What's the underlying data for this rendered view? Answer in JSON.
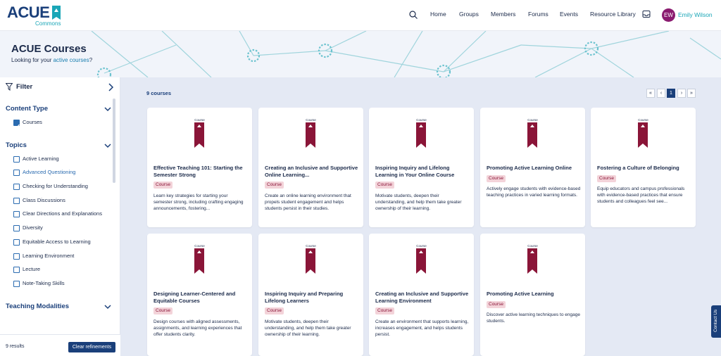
{
  "brand": {
    "name": "ACUE",
    "sub": "Commons",
    "accent": "#1aa6b7",
    "navy": "#1a3f7a",
    "maroon": "#8a1538"
  },
  "nav": {
    "search_icon": "search-icon",
    "items": [
      "Home",
      "Groups",
      "Members",
      "Forums",
      "Events",
      "Resource Library"
    ],
    "inbox_icon": "inbox-icon",
    "avatar_initials": "EW",
    "user_name": "Emily Wilson"
  },
  "hero": {
    "title": "ACUE Courses",
    "subtitle_prefix": "Looking for your ",
    "subtitle_link": "active courses",
    "subtitle_suffix": "?"
  },
  "sidebar": {
    "filter_label": "Filter",
    "content_type": {
      "title": "Content Type",
      "options": [
        {
          "label": "Courses",
          "checked": true
        }
      ]
    },
    "topics": {
      "title": "Topics",
      "options": [
        {
          "label": "Active Learning",
          "checked": false
        },
        {
          "label": "Advanced Questioning",
          "checked": false
        },
        {
          "label": "Checking for Understanding",
          "checked": false
        },
        {
          "label": "Class Discussions",
          "checked": false
        },
        {
          "label": "Clear Directions and Explanations",
          "checked": false
        },
        {
          "label": "Diversity",
          "checked": false
        },
        {
          "label": "Equitable Access to Learning",
          "checked": false
        },
        {
          "label": "Learning Environment",
          "checked": false
        },
        {
          "label": "Lecture",
          "checked": false
        },
        {
          "label": "Note-Taking Skills",
          "checked": false
        }
      ]
    },
    "teaching_modalities": {
      "title": "Teaching Modalities"
    },
    "results_count": "9 results",
    "clear_label": "Clear refinements"
  },
  "main": {
    "count_label": "9 courses",
    "pager": [
      "«",
      "‹",
      "1",
      "›",
      "»"
    ],
    "current_page": "1",
    "ribbon_label": "Course",
    "cards": [
      {
        "title": "Effective Teaching 101: Starting the Semester Strong",
        "badge": "Course",
        "desc": "Learn key strategies for starting your semester strong, including crafting engaging announcements, fostering..."
      },
      {
        "title": "Creating an Inclusive and Supportive Online Learning...",
        "badge": "Course",
        "desc": "Create an online learning environment that propels student engagement and helps students persist in their studies."
      },
      {
        "title": "Inspiring Inquiry and Lifelong Learning in Your Online Course",
        "badge": "Course",
        "desc": "Motivate students, deepen their understanding, and help them take greater ownership of their learning."
      },
      {
        "title": "Promoting Active Learning Online",
        "badge": "Course",
        "desc": "Actively engage students with evidence-based teaching practices in varied learning formats."
      },
      {
        "title": "Fostering a Culture of Belonging",
        "badge": "Course",
        "desc": "Equip educators and campus professionals with evidence-based practices that ensure students and colleagues feel see..."
      },
      {
        "title": "Designing Learner-Centered and Equitable Courses",
        "badge": "Course",
        "desc": "Design courses with aligned assessments, assignments, and learning experiences that offer students clarity."
      },
      {
        "title": "Inspiring Inquiry and Preparing Lifelong Learners",
        "badge": "Course",
        "desc": "Motivate students, deepen their understanding, and help them take greater ownership of their learning."
      },
      {
        "title": "Creating an Inclusive and Supportive Learning Environment",
        "badge": "Course",
        "desc": "Create an environment that supports learning, increases engagement, and helps students persist."
      },
      {
        "title": "Promoting Active Learning",
        "badge": "Course",
        "desc": "Discover active learning techniques to engage students."
      }
    ]
  },
  "contact_tab": "Contact Us"
}
